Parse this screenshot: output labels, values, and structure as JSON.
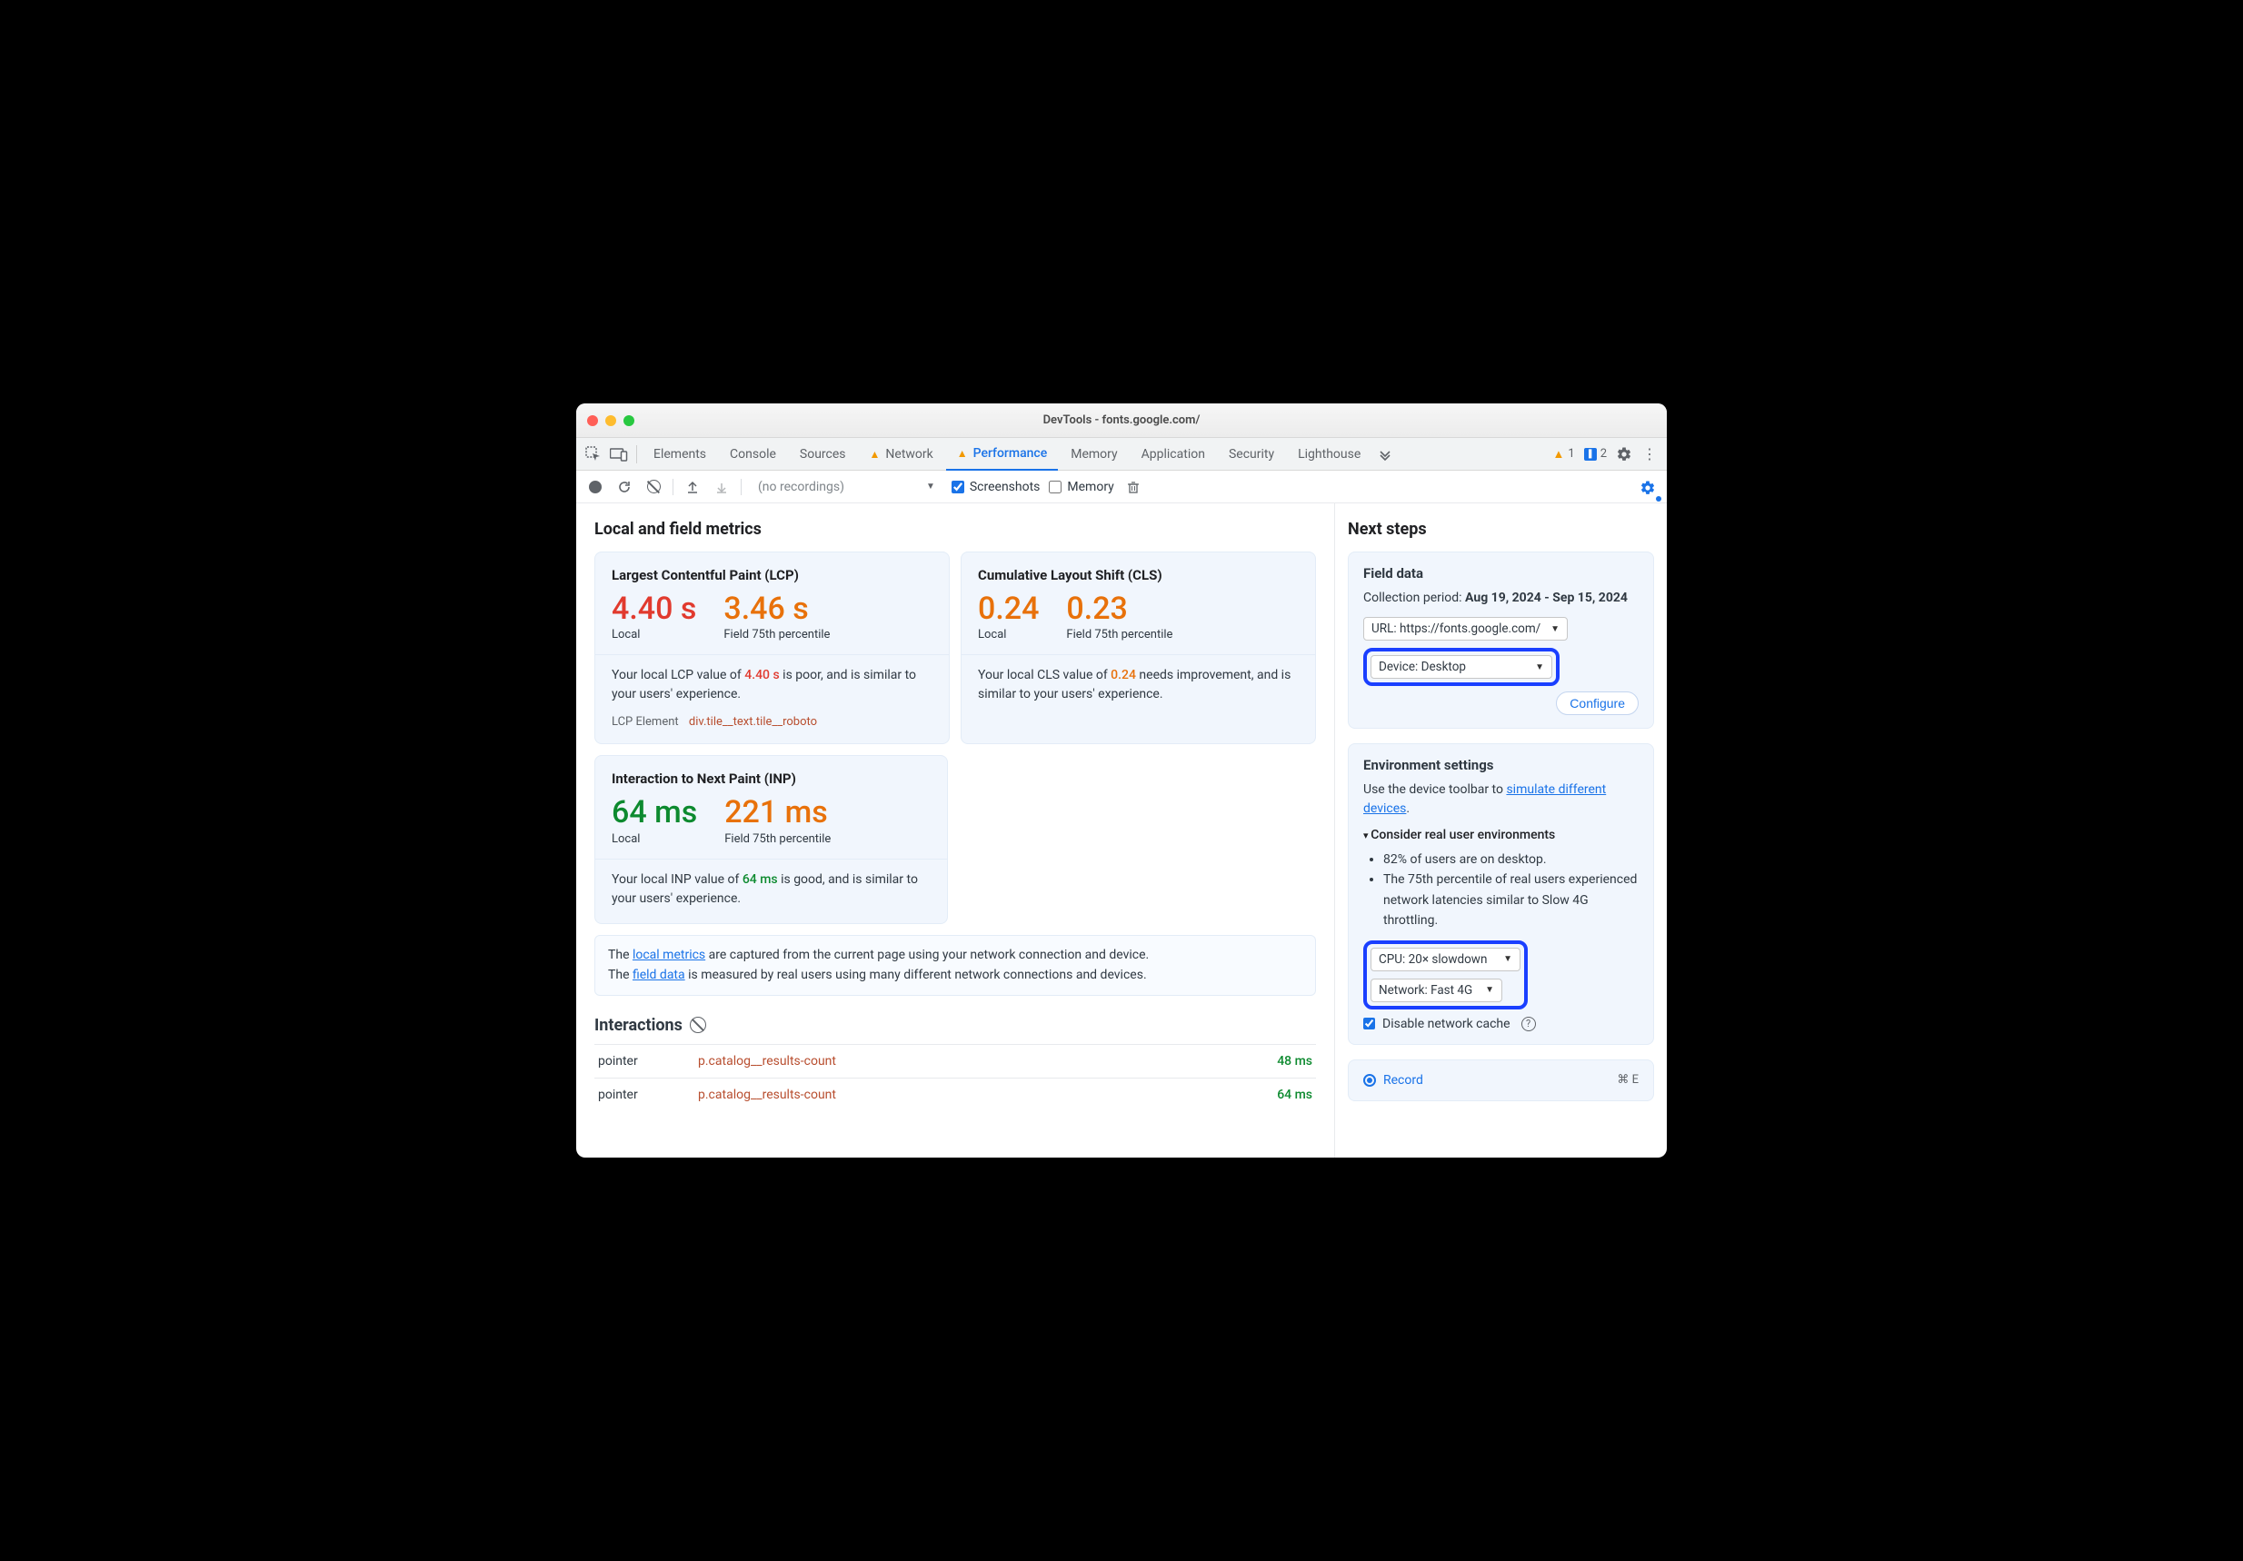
{
  "titlebar": {
    "title": "DevTools - fonts.google.com/"
  },
  "tabs": {
    "inspect": true,
    "items": [
      "Elements",
      "Console",
      "Sources",
      "Network",
      "Performance",
      "Memory",
      "Application",
      "Security",
      "Lighthouse"
    ],
    "warn_tabs": [
      "Network",
      "Performance"
    ],
    "active": "Performance",
    "warn_count": "1",
    "issue_count": "2"
  },
  "toolbar": {
    "recordings": "(no recordings)",
    "screenshots_label": "Screenshots",
    "screenshots_checked": true,
    "memory_label": "Memory",
    "memory_checked": false
  },
  "main": {
    "heading": "Local and field metrics",
    "lcp": {
      "title": "Largest Contentful Paint (LCP)",
      "local_val": "4.40 s",
      "local_lbl": "Local",
      "field_val": "3.46 s",
      "field_lbl": "Field 75th percentile",
      "desc_pre": "Your local LCP value of ",
      "desc_val": "4.40 s",
      "desc_post": " is poor, and is similar to your users' experience.",
      "el_label": "LCP Element",
      "el_selector": "div.tile__text.tile__roboto"
    },
    "cls": {
      "title": "Cumulative Layout Shift (CLS)",
      "local_val": "0.24",
      "local_lbl": "Local",
      "field_val": "0.23",
      "field_lbl": "Field 75th percentile",
      "desc_pre": "Your local CLS value of ",
      "desc_val": "0.24",
      "desc_post": " needs improvement, and is similar to your users' experience."
    },
    "inp": {
      "title": "Interaction to Next Paint (INP)",
      "local_val": "64 ms",
      "local_lbl": "Local",
      "field_val": "221 ms",
      "field_lbl": "Field 75th percentile",
      "desc_pre": "Your local INP value of ",
      "desc_val": "64 ms",
      "desc_post": " is good, and is similar to your users' experience."
    },
    "note": {
      "l1a": "The ",
      "l1_link": "local metrics",
      "l1b": " are captured from the current page using your network connection and device.",
      "l2a": "The ",
      "l2_link": "field data",
      "l2b": " is measured by real users using many different network connections and devices."
    },
    "interactions": {
      "heading": "Interactions",
      "rows": [
        {
          "kind": "pointer",
          "selector": "p.catalog__results-count",
          "ms": "48 ms"
        },
        {
          "kind": "pointer",
          "selector": "p.catalog__results-count",
          "ms": "64 ms"
        }
      ]
    }
  },
  "side": {
    "heading": "Next steps",
    "field": {
      "title": "Field data",
      "period_lbl": "Collection period: ",
      "period_val": "Aug 19, 2024 - Sep 15, 2024",
      "url_select": "URL: https://fonts.google.com/",
      "device_select": "Device: Desktop",
      "configure": "Configure"
    },
    "env": {
      "title": "Environment settings",
      "hint_a": "Use the device toolbar to ",
      "hint_link": "simulate different devices",
      "hint_b": ".",
      "disclosure": "Consider real user environments",
      "bullets": [
        "82% of users are on desktop.",
        "The 75th percentile of real users experienced network latencies similar to Slow 4G throttling."
      ],
      "cpu_select": "CPU: 20× slowdown",
      "net_select": "Network: Fast 4G",
      "disable_cache": "Disable network cache"
    },
    "record": {
      "label": "Record",
      "shortcut": "⌘ E"
    }
  }
}
